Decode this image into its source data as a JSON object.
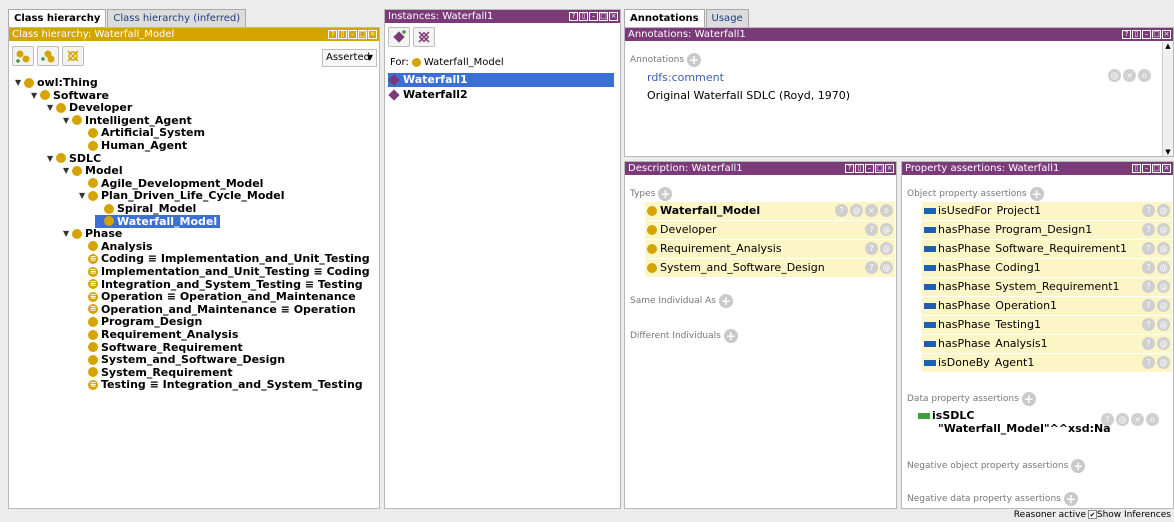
{
  "class_tabs": [
    "Class hierarchy",
    "Class hierarchy (inferred)"
  ],
  "class_header": "Class hierarchy: Waterfall_Model",
  "asserted_dropdown": "Asserted",
  "tree": [
    {
      "label": "owl:Thing",
      "twisty": "▼"
    },
    {
      "label": "Software",
      "twisty": "▼"
    },
    {
      "label": "Developer",
      "twisty": "▼"
    },
    {
      "label": "Intelligent_Agent",
      "twisty": "▼"
    },
    {
      "label": "Artificial_System"
    },
    {
      "label": "Human_Agent"
    },
    {
      "label": "SDLC",
      "twisty": "▼"
    },
    {
      "label": "Model",
      "twisty": "▼"
    },
    {
      "label": "Agile_Development_Model"
    },
    {
      "label": "Plan_Driven_Life_Cycle_Model",
      "twisty": "▼"
    },
    {
      "label": "Spiral_Model"
    },
    {
      "label": "Waterfall_Model"
    },
    {
      "label": "Phase",
      "twisty": "▼"
    },
    {
      "label": "Analysis"
    },
    {
      "label": "Coding ≡ Implementation_and_Unit_Testing"
    },
    {
      "label": "Implementation_and_Unit_Testing ≡ Coding"
    },
    {
      "label": "Integration_and_System_Testing ≡ Testing"
    },
    {
      "label": "Operation ≡ Operation_and_Maintenance"
    },
    {
      "label": "Operation_and_Maintenance ≡ Operation"
    },
    {
      "label": "Program_Design"
    },
    {
      "label": "Requirement_Analysis"
    },
    {
      "label": "Software_Requirement"
    },
    {
      "label": "System_and_Software_Design"
    },
    {
      "label": "System_Requirement"
    },
    {
      "label": "Testing ≡ Integration_and_System_Testing"
    }
  ],
  "instances": {
    "header": "Instances: Waterfall1",
    "for_label": "For:",
    "for_class": "Waterfall_Model",
    "items": [
      "Waterfall1",
      "Waterfall2"
    ]
  },
  "ann_tabs": [
    "Annotations",
    "Usage"
  ],
  "annotations": {
    "header": "Annotations: Waterfall1",
    "section": "Annotations",
    "property": "rdfs:comment",
    "value": "Original Waterfall SDLC (Royd, 1970)"
  },
  "description": {
    "header": "Description: Waterfall1",
    "types_label": "Types",
    "types": [
      "Waterfall_Model",
      "Developer",
      "Requirement_Analysis",
      "System_and_Software_Design"
    ],
    "same_label": "Same Individual As",
    "different_label": "Different Individuals"
  },
  "property": {
    "header": "Property assertions: Waterfall1",
    "object_label": "Object property assertions",
    "object": [
      {
        "prop": "isUsedFor",
        "value": "Project1"
      },
      {
        "prop": "hasPhase",
        "value": "Program_Design1"
      },
      {
        "prop": "hasPhase",
        "value": "Software_Requirement1"
      },
      {
        "prop": "hasPhase",
        "value": "Coding1"
      },
      {
        "prop": "hasPhase",
        "value": "System_Requirement1"
      },
      {
        "prop": "hasPhase",
        "value": "Operation1"
      },
      {
        "prop": "hasPhase",
        "value": "Testing1"
      },
      {
        "prop": "hasPhase",
        "value": "Analysis1"
      },
      {
        "prop": "isDoneBy",
        "value": "Agent1"
      }
    ],
    "data_label": "Data property assertions",
    "data_prop": "isSDLC",
    "data_value": "\"Waterfall_Model\"^^xsd:Na",
    "neg_obj_label": "Negative object property assertions",
    "neg_data_label": "Negative data property assertions"
  },
  "status": {
    "reasoner": "Reasoner active",
    "show_inferences": "Show Inferences"
  },
  "colors": {
    "class": "#d4a400",
    "individual": "#7b3a78",
    "selection": "#3b6fd4",
    "object_prop": "#1f5fb0",
    "data_prop": "#3aa23a"
  }
}
